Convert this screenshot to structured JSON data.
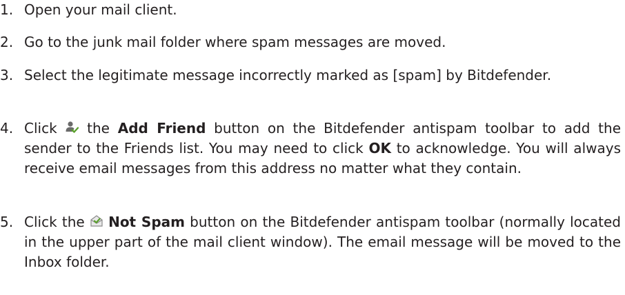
{
  "steps": [
    {
      "number": "1.",
      "text": "Open your mail client."
    },
    {
      "number": "2.",
      "text": "Go to the junk mail folder where spam messages are moved."
    },
    {
      "number": "3.",
      "text": "Select the legitimate message incorrectly marked as [spam] by Bitdefender."
    },
    {
      "number": "4.",
      "pre": "Click",
      "icon": "add-friend-icon",
      "mid_before": " the ",
      "button_label": "Add Friend",
      "mid_after": " button on the Bitdefender antispam toolbar to add the sender to the Friends list. You may need to click ",
      "ok_label": "OK",
      "post": " to acknowledge. You will always receive email messages from this address no matter what they contain."
    },
    {
      "number": "5.",
      "pre": "Click the ",
      "icon": "not-spam-icon",
      "button_label": "Not Spam",
      "post": " button on the Bitdefender antispam toolbar (normally located in the upper part of the mail client window). The email message will be moved to the Inbox folder."
    }
  ],
  "colors": {
    "text": "#231f20",
    "icon_person": "#6a6a6a",
    "icon_check": "#5aa02c",
    "icon_envelope": "#8a8a8a"
  }
}
